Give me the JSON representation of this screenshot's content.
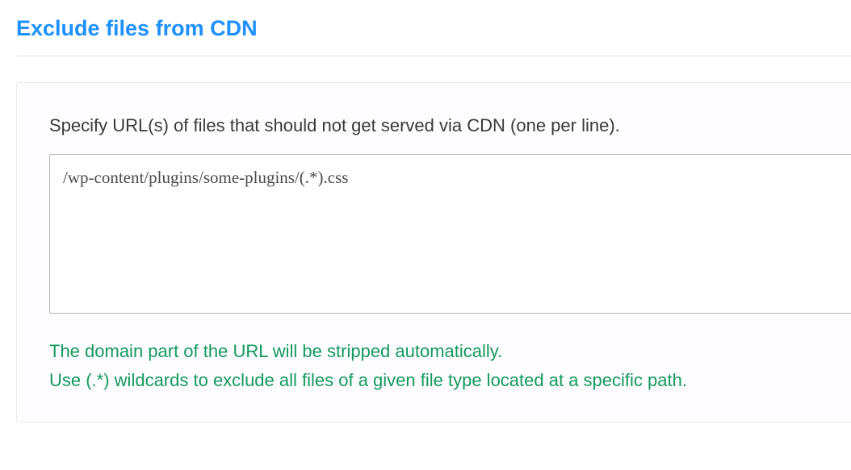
{
  "section": {
    "title": "Exclude files from CDN",
    "description": "Specify URL(s) of files that should not get served via CDN (one per line).",
    "textarea_value": "/wp-content/plugins/some-plugins/(.*).css",
    "help_lines": [
      "The domain part of the URL will be stripped automatically.",
      "Use (.*) wildcards to exclude all files of a given file type located at a specific path."
    ]
  }
}
